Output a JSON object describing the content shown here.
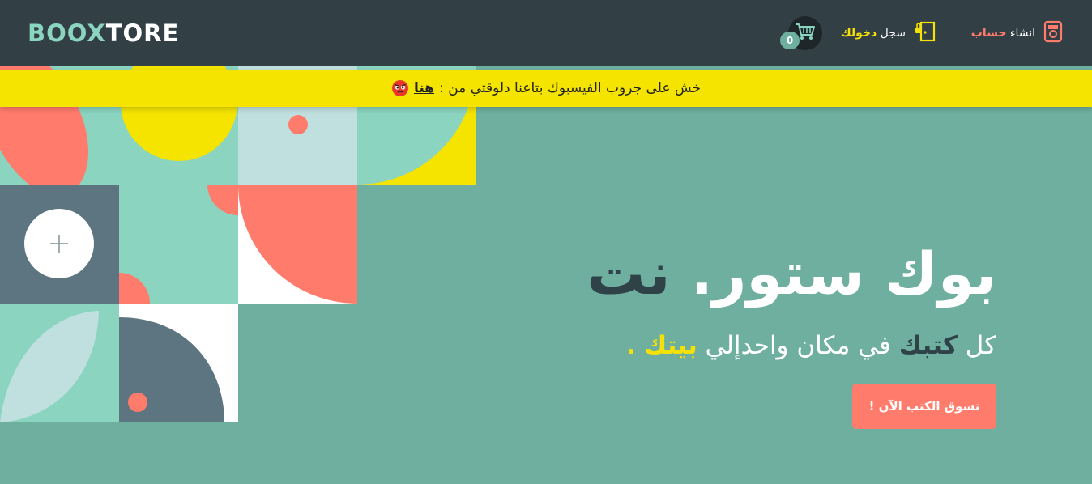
{
  "header": {
    "logo_part1": "BOOX",
    "logo_part2": "TORE",
    "signup_prefix": "انشاء",
    "signup_highlight": "حساب",
    "login_prefix": "سجل",
    "login_highlight": "دخولك",
    "cart_count": "0",
    "icons": [
      "signup-icon",
      "login-door-icon",
      "cart-icon"
    ]
  },
  "notice": {
    "text": "خش على جروب الفيسبوك بتاعنا دلوقتي من :",
    "link": "هنا",
    "emoji": "angry-face-icon"
  },
  "hero": {
    "title_part1": "بوك ستور.",
    "title_part2": "نت",
    "subtitle_part1": "كل",
    "subtitle_part2": "كتبك",
    "subtitle_part3": "في مكان واحدإلي",
    "subtitle_part4": "بيتك",
    "subtitle_part5": ".",
    "cta_label": "تسوق الكتب الآن !"
  },
  "colors": {
    "header_bg": "#323f45",
    "page_bg": "#6faf9f",
    "mint": "#8ad4c0",
    "coral": "#ff7b6c",
    "yellow": "#f4e400",
    "slate": "#5d7580",
    "pale": "#c0e0e0"
  }
}
